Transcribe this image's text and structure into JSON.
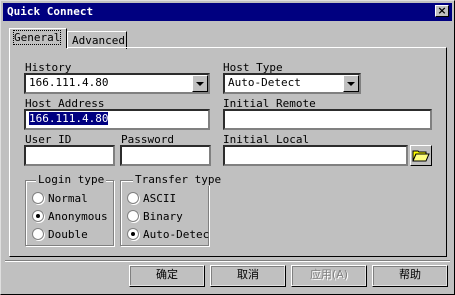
{
  "window": {
    "title": "Quick Connect",
    "close": "×"
  },
  "tabs": [
    {
      "label": "General"
    },
    {
      "label": "Advanced"
    }
  ],
  "history": {
    "label": "History",
    "value": "166.111.4.80"
  },
  "host_type": {
    "label": "Host Type",
    "value": "Auto-Detect"
  },
  "host_address": {
    "label": "Host Address",
    "value": "166.111.4.80"
  },
  "initial_remote": {
    "label": "Initial Remote",
    "value": ""
  },
  "user_id": {
    "label": "User ID",
    "value": ""
  },
  "password": {
    "label": "Password",
    "value": ""
  },
  "initial_local": {
    "label": "Initial Local",
    "value": ""
  },
  "login_type": {
    "label": "Login type",
    "options": [
      {
        "label": "Normal",
        "selected": false
      },
      {
        "label": "Anonymous",
        "selected": true
      },
      {
        "label": "Double",
        "selected": false
      }
    ]
  },
  "transfer_type": {
    "label": "Transfer type",
    "options": [
      {
        "label": "ASCII",
        "selected": false
      },
      {
        "label": "Binary",
        "selected": false
      },
      {
        "label": "Auto-Detec",
        "selected": true
      }
    ]
  },
  "buttons": {
    "ok": "确定",
    "cancel": "取消",
    "apply": "应用(A)",
    "help": "帮助"
  },
  "icons": {
    "folder": "folder-open-icon"
  }
}
